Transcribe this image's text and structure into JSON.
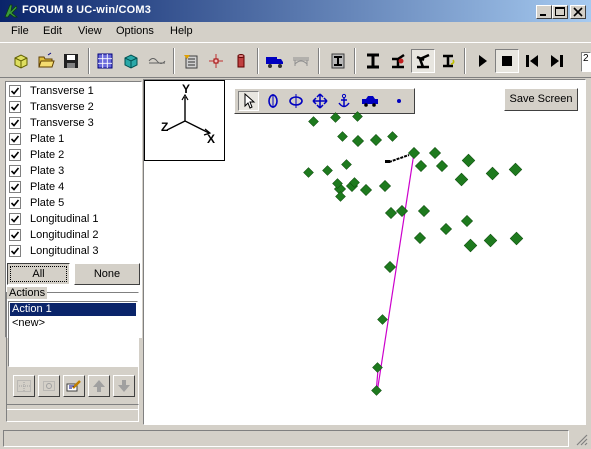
{
  "window": {
    "title": "FORUM 8    UC-win/COM3"
  },
  "menu": [
    "File",
    "Edit",
    "View",
    "Options",
    "Help"
  ],
  "toolbar": {
    "frame_number": "2"
  },
  "layers": [
    {
      "label": "Transverse 1",
      "checked": true
    },
    {
      "label": "Transverse 2",
      "checked": true
    },
    {
      "label": "Transverse 3",
      "checked": true
    },
    {
      "label": "Plate 1",
      "checked": true
    },
    {
      "label": "Plate 2",
      "checked": true
    },
    {
      "label": "Plate 3",
      "checked": true
    },
    {
      "label": "Plate 4",
      "checked": true
    },
    {
      "label": "Plate 5",
      "checked": true
    },
    {
      "label": "Longitudinal 1",
      "checked": true
    },
    {
      "label": "Longitudinal 2",
      "checked": true
    },
    {
      "label": "Longitudinal 3",
      "checked": true
    }
  ],
  "select_buttons": {
    "all": "All",
    "none": "None"
  },
  "actions": {
    "title": "Actions",
    "items": [
      {
        "label": "Action 1",
        "selected": true
      },
      {
        "label": "<new>",
        "selected": false
      }
    ]
  },
  "viewport": {
    "save_label": "Save Screen",
    "axes": {
      "y": "Y",
      "z": "Z",
      "x": "X"
    }
  },
  "colors": {
    "node": "#1e7a1e",
    "member": "#cc00cc",
    "title_start": "#0a246a",
    "title_end": "#a6caf0",
    "selection": "#0a246a"
  }
}
